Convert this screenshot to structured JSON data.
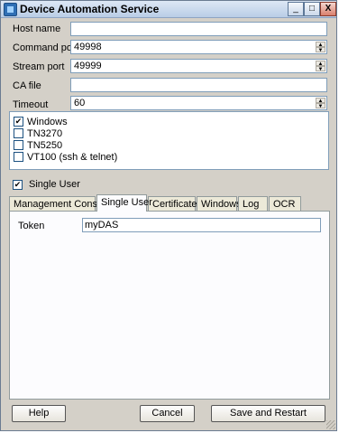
{
  "window": {
    "title": "Device Automation Service",
    "controls": {
      "minimize": "_",
      "maximize": "□",
      "close": "X"
    }
  },
  "form": {
    "host_name": {
      "label": "Host name",
      "value": ""
    },
    "command_port": {
      "label": "Command port",
      "value": "49998"
    },
    "stream_port": {
      "label": "Stream port",
      "value": "49999"
    },
    "ca_file": {
      "label": "CA file",
      "value": ""
    },
    "timeout": {
      "label": "Timeout",
      "value": "60"
    }
  },
  "device_types": [
    {
      "label": "Windows",
      "checked": true
    },
    {
      "label": "TN3270",
      "checked": false
    },
    {
      "label": "TN5250",
      "checked": false
    },
    {
      "label": "VT100 (ssh & telnet)",
      "checked": false
    }
  ],
  "single_user_checkbox": {
    "label": "Single User",
    "checked": true
  },
  "tabs": [
    {
      "label": "Management Console",
      "active": false
    },
    {
      "label": "Single User",
      "active": true
    },
    {
      "label": "Certificates",
      "active": false
    },
    {
      "label": "Windows",
      "active": false
    },
    {
      "label": "Log",
      "active": false
    },
    {
      "label": "OCR",
      "active": false
    }
  ],
  "single_user_panel": {
    "token_label": "Token",
    "token_value": "myDAS"
  },
  "buttons": {
    "help": "Help",
    "cancel": "Cancel",
    "save_restart": "Save and Restart"
  },
  "check_mark": "✔"
}
